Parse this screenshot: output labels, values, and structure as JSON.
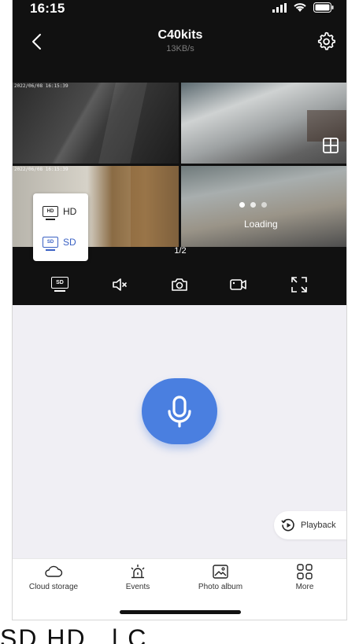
{
  "status": {
    "time": "16:15"
  },
  "header": {
    "title": "C40kits",
    "subtitle": "13KB/s"
  },
  "cameras": [
    {
      "timestamp": "2022/06/08 16:15:39"
    },
    {
      "timestamp": ""
    },
    {
      "timestamp": "2022/06/08 16:15:39"
    },
    {
      "loading_label": "Loading"
    }
  ],
  "quality_menu": {
    "hd_label": "HD",
    "sd_label": "SD",
    "hd_icon_text": "HD",
    "sd_icon_text": "SD",
    "selected": "SD"
  },
  "pager": "1/2",
  "toolbar": {
    "sd_label": "SD"
  },
  "playback_label": "Playback",
  "tabs": [
    {
      "label": "Cloud storage",
      "icon": "cloud-icon"
    },
    {
      "label": "Events",
      "icon": "alarm-icon"
    },
    {
      "label": "Photo album",
      "icon": "photo-icon"
    },
    {
      "label": "More",
      "icon": "grid-icon"
    }
  ],
  "below_text": "SD     HD     . l     C",
  "colors": {
    "accent": "#4a7fe0",
    "selected": "#3b62c4",
    "dark": "#111111",
    "background": "#f0eff4"
  }
}
